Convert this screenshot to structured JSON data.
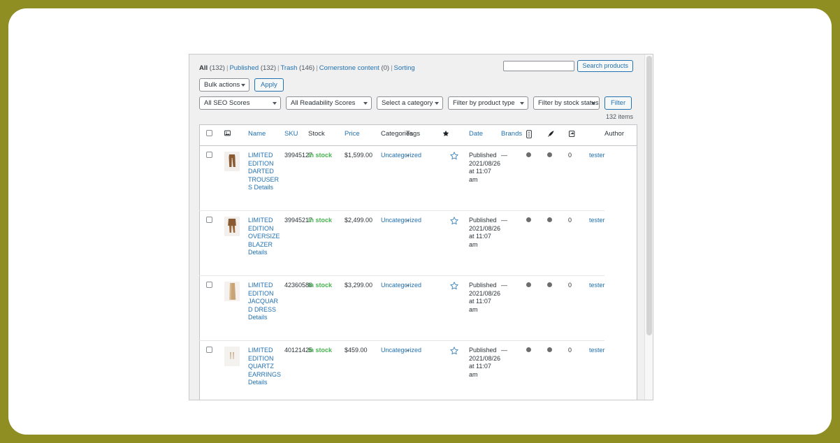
{
  "theme": {
    "page_background": "#8e8e23",
    "panel_background": "#f0f0f1",
    "link_color": "#2271b1",
    "in_stock_color": "#46b450",
    "text_color": "#2c3338"
  },
  "views_nav": {
    "items": [
      {
        "label": "All",
        "count": "(132)",
        "current": true
      },
      {
        "label": "Published",
        "count": "(132)",
        "current": false
      },
      {
        "label": "Trash",
        "count": "(146)",
        "current": false
      },
      {
        "label": "Cornerstone content",
        "count": "(0)",
        "current": false
      },
      {
        "label": "Sorting",
        "count": "",
        "current": false
      }
    ],
    "separator": "|"
  },
  "search": {
    "value": "",
    "placeholder": "",
    "button_label": "Search products"
  },
  "toolbar": {
    "bulk_actions_label": "Bulk actions",
    "apply_label": "Apply",
    "seo_scores_label": "All SEO Scores",
    "readability_scores_label": "All Readability Scores",
    "category_label": "Select a category",
    "product_type_label": "Filter by product type",
    "stock_status_label": "Filter by stock status",
    "filter_label": "Filter"
  },
  "items_count": "132 items",
  "table": {
    "headers": {
      "checkbox": "",
      "image": "image-icon",
      "name": "Name",
      "sku": "SKU",
      "stock": "Stock",
      "price": "Price",
      "categories": "Categories",
      "tags": "Tags",
      "featured": "star-icon",
      "date": "Date",
      "brands": "Brands",
      "icon_mobile": "mobile-icon",
      "icon_pen": "pen-icon",
      "icon_share": "share-icon",
      "count": "",
      "author": "Author"
    },
    "rows": [
      {
        "name": "LIMITED EDITION DARTED TROUSERS",
        "details": "Details",
        "sku": "39945127",
        "stock": "In stock",
        "price": "$1,599.00",
        "categories": "Uncategorized",
        "tags": "–",
        "featured": "star-outline-icon",
        "date_status": "Published",
        "date_value": "2021/08/26 at 11:07 am",
        "brands": "—",
        "dot1": "grey-dot",
        "dot2": "grey-dot",
        "count": "0",
        "author": "tester",
        "thumb_color": "#8a5b32",
        "thumb_kind": "trousers"
      },
      {
        "name": "LIMITED EDITION OVERSIZE BLAZER",
        "details": "Details",
        "sku": "39945217",
        "stock": "In stock",
        "price": "$2,499.00",
        "categories": "Uncategorized",
        "tags": "–",
        "featured": "star-outline-icon",
        "date_status": "Published",
        "date_value": "2021/08/26 at 11:07 am",
        "brands": "—",
        "dot1": "grey-dot",
        "dot2": "grey-dot",
        "count": "0",
        "author": "tester",
        "thumb_color": "#8a5b32",
        "thumb_kind": "blazer"
      },
      {
        "name": "LIMITED EDITION JACQUARD DRESS",
        "details": "Details",
        "sku": "42360586",
        "stock": "In stock",
        "price": "$3,299.00",
        "categories": "Uncategorized",
        "tags": "–",
        "featured": "star-outline-icon",
        "date_status": "Published",
        "date_value": "2021/08/26 at 11:07 am",
        "brands": "—",
        "dot1": "grey-dot",
        "dot2": "grey-dot",
        "count": "0",
        "author": "tester",
        "thumb_color": "#c9a477",
        "thumb_kind": "dress"
      },
      {
        "name": "LIMITED EDITION QUARTZ EARRINGS",
        "details": "Details",
        "sku": "40121425",
        "stock": "In stock",
        "price": "$459.00",
        "categories": "Uncategorized",
        "tags": "–",
        "featured": "star-outline-icon",
        "date_status": "Published",
        "date_value": "2021/08/26 at 11:07 am",
        "brands": "—",
        "dot1": "grey-dot",
        "dot2": "grey-dot",
        "count": "0",
        "author": "tester",
        "thumb_color": "#c2a07a",
        "thumb_kind": "earrings"
      }
    ]
  }
}
